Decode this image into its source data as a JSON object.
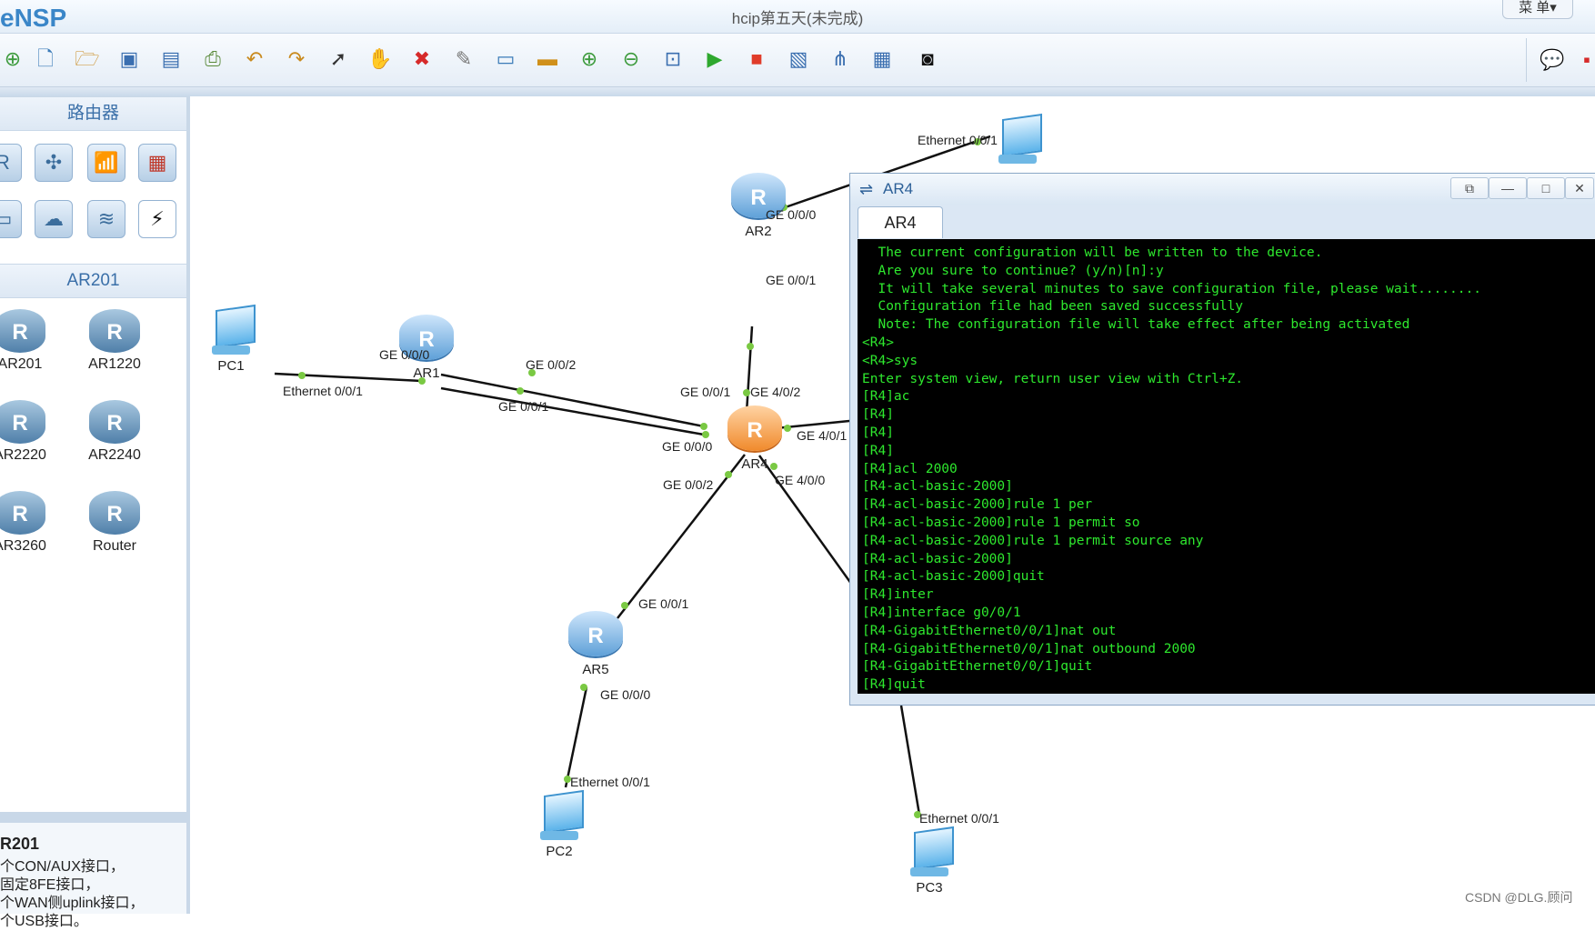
{
  "app": {
    "logo": "eNSP",
    "title": "hcip第五天(未完成)",
    "menu": "菜 单▾"
  },
  "toolbar": {
    "icons": [
      "new-topology-icon",
      "new-file-icon",
      "open-icon",
      "save-icon",
      "save-as-icon",
      "print-icon",
      "undo-icon",
      "redo-icon",
      "select-icon",
      "pan-hand-icon",
      "delete-icon",
      "delete-link-icon",
      "text-icon",
      "rectangle-icon",
      "zoom-in-icon",
      "zoom-out-icon",
      "fit-icon",
      "start-icon",
      "stop-icon",
      "capture-icon",
      "topology-icon",
      "grid-icon",
      "console-icon"
    ]
  },
  "left_panel": {
    "category_title": "路由器",
    "model_title": "AR201",
    "devices": [
      {
        "label": "AR201"
      },
      {
        "label": "AR1220"
      },
      {
        "label": "AR2220"
      },
      {
        "label": "AR2240"
      },
      {
        "label": "AR3260"
      },
      {
        "label": "Router"
      }
    ],
    "desc_title": "R201",
    "desc_lines": [
      "个CON/AUX接口，",
      "固定8FE接口，",
      "个WAN侧uplink接口，",
      "个USB接口。"
    ]
  },
  "topology": {
    "nodes": [
      {
        "label": "PC1"
      },
      {
        "label": "AR1"
      },
      {
        "label": "AR2"
      },
      {
        "label": "AR4"
      },
      {
        "label": "AR5"
      },
      {
        "label": "PC2"
      },
      {
        "label": "PC3"
      }
    ],
    "ports": [
      "Ethernet 0/0/1",
      "GE 0/0/0",
      "GE 0/0/2",
      "GE 0/0/1",
      "GE 0/0/1",
      "GE 4/0/2",
      "GE 0/0/0",
      "GE 4/0/1",
      "GE 0/0/2",
      "GE 4/0/0",
      "GE 0/0/1",
      "GE 0/0/0",
      "Ethernet 0/0/1",
      "Ethernet 0/0/1",
      "GE 0/0/0",
      "GE 0/0/1",
      "Ethernet 0/0/1"
    ]
  },
  "terminal": {
    "title": "AR4",
    "tab": "AR4",
    "lines": [
      "  The current configuration will be written to the device.",
      "  Are you sure to continue? (y/n)[n]:y",
      "  It will take several minutes to save configuration file, please wait........",
      "  Configuration file had been saved successfully",
      "  Note: The configuration file will take effect after being activated",
      "<R4>",
      "<R4>sys",
      "Enter system view, return user view with Ctrl+Z.",
      "[R4]ac",
      "[R4]",
      "[R4]",
      "[R4]",
      "[R4]acl 2000",
      "[R4-acl-basic-2000]",
      "[R4-acl-basic-2000]rule 1 per",
      "[R4-acl-basic-2000]rule 1 permit so",
      "[R4-acl-basic-2000]rule 1 permit source any",
      "[R4-acl-basic-2000]",
      "[R4-acl-basic-2000]quit",
      "[R4]inter",
      "[R4]interface g0/0/1",
      "[R4-GigabitEthernet0/0/1]nat out",
      "[R4-GigabitEthernet0/0/1]nat outbound 2000",
      "[R4-GigabitEthernet0/0/1]quit",
      "[R4]quit"
    ]
  },
  "watermark": "CSDN @DLG.顾问"
}
